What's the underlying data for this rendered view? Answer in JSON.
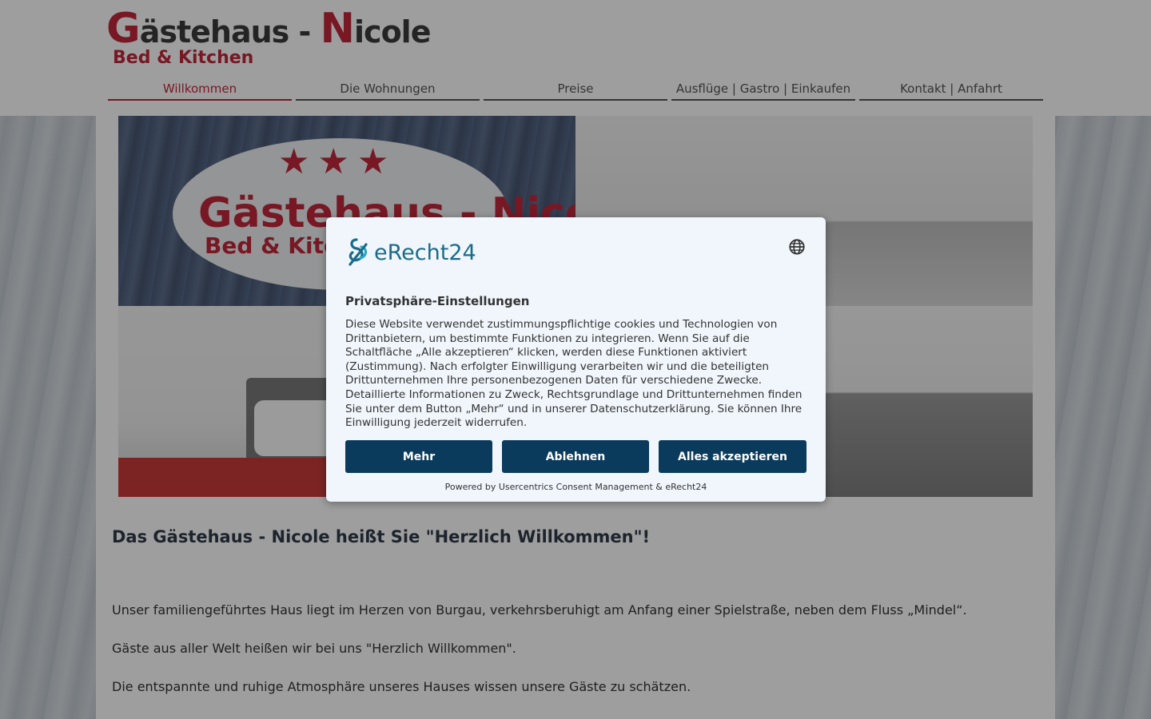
{
  "header": {
    "logo": {
      "line1_initial_1": "G",
      "line1_rest_1": "ästehaus - ",
      "line1_initial_2": "N",
      "line1_rest_2": "icole",
      "line2": "Bed & Kitchen"
    },
    "nav": [
      {
        "label": "Willkommen",
        "active": true
      },
      {
        "label": "Die Wohnungen",
        "active": false
      },
      {
        "label": "Preise",
        "active": false
      },
      {
        "label": "Ausflüge | Gastro | Einkaufen",
        "active": false
      },
      {
        "label": "Kontakt | Anfahrt",
        "active": false
      }
    ],
    "accent_color": "#c0283a"
  },
  "hero": {
    "sign_stars": "★★★",
    "sign_line1": "Gästehaus - Nicole",
    "sign_line2": "Bed & Kitchen"
  },
  "main": {
    "heading": "Das Gästehaus - Nicole heißt Sie \"Herzlich Willkommen\"!",
    "paragraphs": [
      "Unser familiengeführtes Haus liegt im Herzen von Burgau, verkehrsberuhigt am Anfang einer Spielstraße, neben dem Fluss „Mindel“.",
      "Gäste aus aller Welt heißen wir bei uns \"Herzlich Willkommen\".",
      "Die entspannte und ruhige Atmosphäre unseres Hauses wissen unsere Gäste zu schätzen."
    ]
  },
  "consent": {
    "brand_name": "eRecht24",
    "title": "Privatsphäre-Einstellungen",
    "text": "Diese Website verwendet zustimmungspflichtige cookies und Technologien von Drittanbietern, um bestimmte Funktionen zu integrieren. Wenn Sie auf die Schaltfläche „Alle akzeptieren“ klicken, werden diese Funktionen aktiviert (Zustimmung). Nach erfolgter Einwilligung verarbeiten wir und die beteiligten Drittunternehmen Ihre personenbezogenen Daten für verschiedene Zwecke. Detaillierte Informationen zu Zweck, Rechtsgrundlage und Drittunternehmen finden Sie unter dem Button „Mehr“ und in unserer Datenschutzerklärung. Sie können Ihre Einwilligung jederzeit widerrufen.",
    "buttons": {
      "more": "Mehr",
      "decline": "Ablehnen",
      "accept_all": "Alles akzeptieren"
    },
    "powered_by": "Powered by Usercentrics Consent Management & eRecht24",
    "button_color": "#0b3b5c",
    "icons": {
      "language": "globe-icon",
      "brand": "erecht24-logo-icon"
    }
  }
}
